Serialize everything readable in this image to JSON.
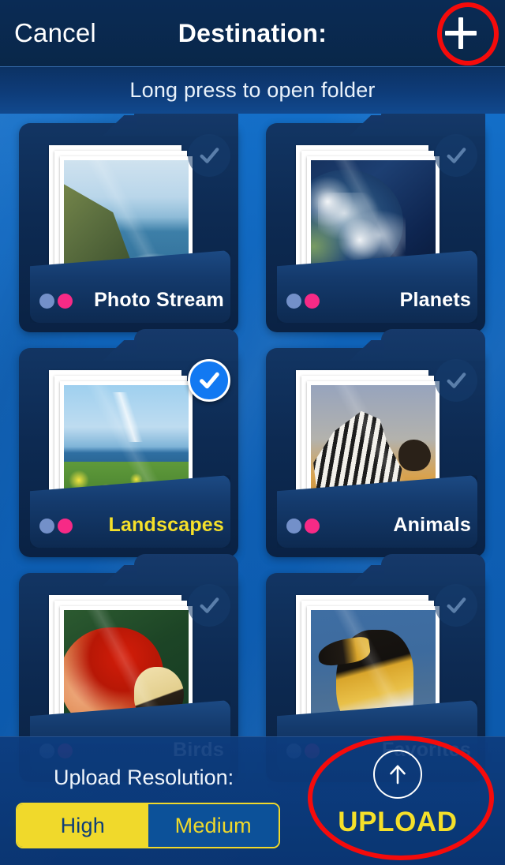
{
  "header": {
    "cancel_label": "Cancel",
    "title": "Destination:",
    "add_icon": "plus-icon"
  },
  "subtitle_bar": {
    "hint": "Long press to open folder"
  },
  "folders": [
    {
      "name": "Photo Stream",
      "selected": false,
      "scene": "coast",
      "check_icon": "check-icon"
    },
    {
      "name": "Planets",
      "selected": false,
      "scene": "earth",
      "check_icon": "check-icon"
    },
    {
      "name": "Landscapes",
      "selected": true,
      "scene": "meadow",
      "check_icon": "check-icon"
    },
    {
      "name": "Animals",
      "selected": false,
      "scene": "zebra",
      "check_icon": "check-icon"
    },
    {
      "name": "Birds",
      "selected": false,
      "scene": "parrot",
      "check_icon": "check-icon"
    },
    {
      "name": "Favorites",
      "selected": false,
      "scene": "penguin",
      "check_icon": "check-icon"
    }
  ],
  "bottom_bar": {
    "resolution_label": "Upload Resolution:",
    "resolution_options": [
      "High",
      "Medium"
    ],
    "resolution_selected": "High",
    "upload_label": "UPLOAD",
    "upload_icon": "arrow-up-icon"
  },
  "annotations": {
    "color": "#f50b0b",
    "targets": [
      "add-button",
      "upload-button"
    ]
  },
  "colors": {
    "background_blue": "#0f62b8",
    "navbar_navy": "#0a2b55",
    "folder_navy": "#0d2a52",
    "accent_yellow": "#f5e02a",
    "selected_blue": "#1279f2",
    "dot_blue": "#7390c9",
    "dot_pink": "#f72a86"
  }
}
